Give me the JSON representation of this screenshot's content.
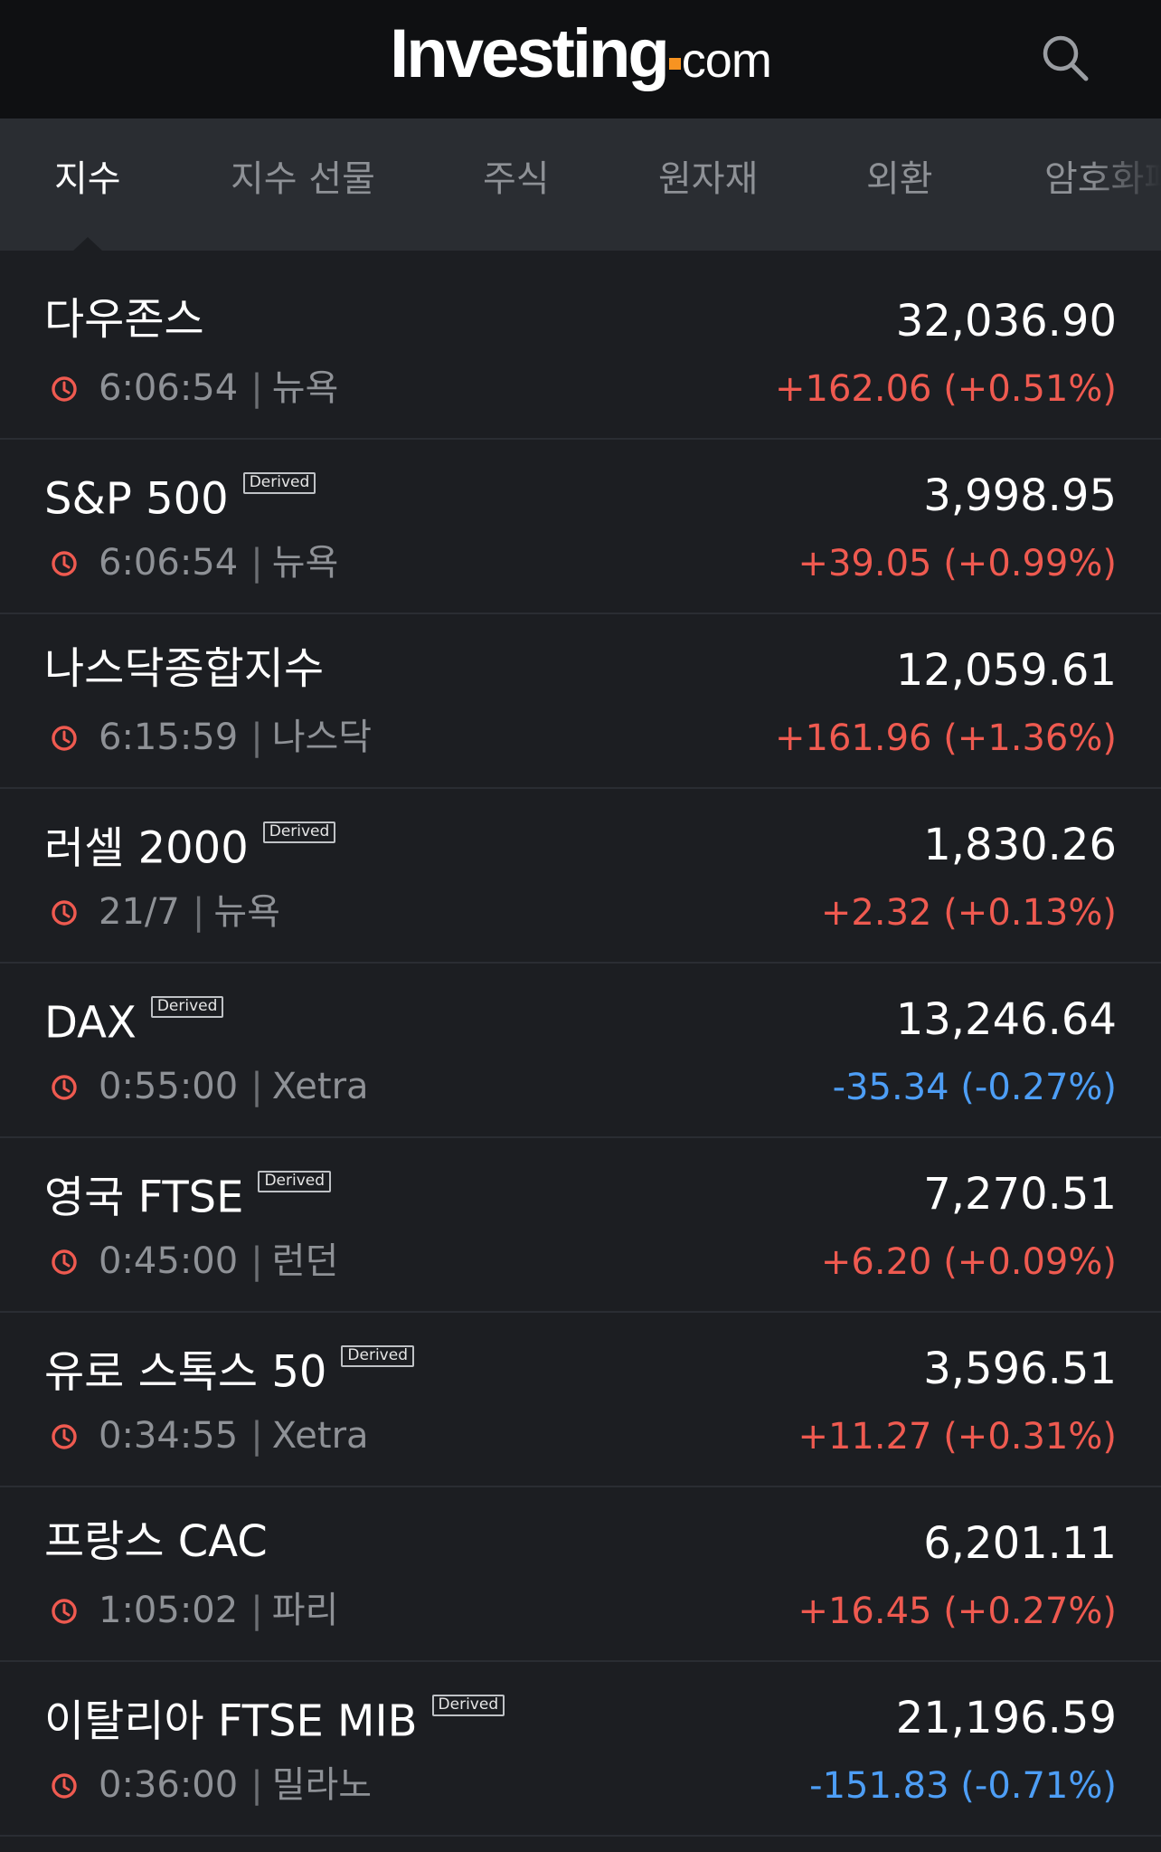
{
  "header": {
    "logo_main": "Investing",
    "logo_com": "com",
    "brand_dot_color": "#f79321",
    "search_icon": "search-icon"
  },
  "tabs": [
    {
      "label": "지수",
      "active": true
    },
    {
      "label": "지수 선물",
      "active": false
    },
    {
      "label": "주식",
      "active": false
    },
    {
      "label": "원자재",
      "active": false
    },
    {
      "label": "외환",
      "active": false
    },
    {
      "label": "암호화폐",
      "active": false
    }
  ],
  "colors": {
    "up": "#ef5a50",
    "down": "#4d9ef6",
    "clock": "#ef5a50"
  },
  "indices": [
    {
      "name": "다우존스",
      "derived": false,
      "time": "6:06:54",
      "exchange": "뉴욕",
      "price": "32,036.90",
      "change": "+162.06 (+0.51%)",
      "direction": "up"
    },
    {
      "name": "S&P 500",
      "derived": true,
      "derived_label": "Derived",
      "time": "6:06:54",
      "exchange": "뉴욕",
      "price": "3,998.95",
      "change": "+39.05 (+0.99%)",
      "direction": "up"
    },
    {
      "name": "나스닥종합지수",
      "derived": false,
      "time": "6:15:59",
      "exchange": "나스닥",
      "price": "12,059.61",
      "change": "+161.96 (+1.36%)",
      "direction": "up"
    },
    {
      "name": "러셀 2000",
      "derived": true,
      "derived_label": "Derived",
      "time": "21/7",
      "exchange": "뉴욕",
      "price": "1,830.26",
      "change": "+2.32 (+0.13%)",
      "direction": "up"
    },
    {
      "name": "DAX",
      "derived": true,
      "derived_label": "Derived",
      "time": "0:55:00",
      "exchange": "Xetra",
      "price": "13,246.64",
      "change": "-35.34 (-0.27%)",
      "direction": "down"
    },
    {
      "name": "영국 FTSE",
      "derived": true,
      "derived_label": "Derived",
      "time": "0:45:00",
      "exchange": "런던",
      "price": "7,270.51",
      "change": "+6.20 (+0.09%)",
      "direction": "up"
    },
    {
      "name": "유로 스톡스 50",
      "derived": true,
      "derived_label": "Derived",
      "time": "0:34:55",
      "exchange": "Xetra",
      "price": "3,596.51",
      "change": "+11.27 (+0.31%)",
      "direction": "up"
    },
    {
      "name": "프랑스 CAC",
      "derived": false,
      "time": "1:05:02",
      "exchange": "파리",
      "price": "6,201.11",
      "change": "+16.45 (+0.27%)",
      "direction": "up"
    },
    {
      "name": "이탈리아 FTSE MIB",
      "derived": true,
      "derived_label": "Derived",
      "time": "0:36:00",
      "exchange": "밀라노",
      "price": "21,196.59",
      "change": "-151.83 (-0.71%)",
      "direction": "down"
    }
  ]
}
